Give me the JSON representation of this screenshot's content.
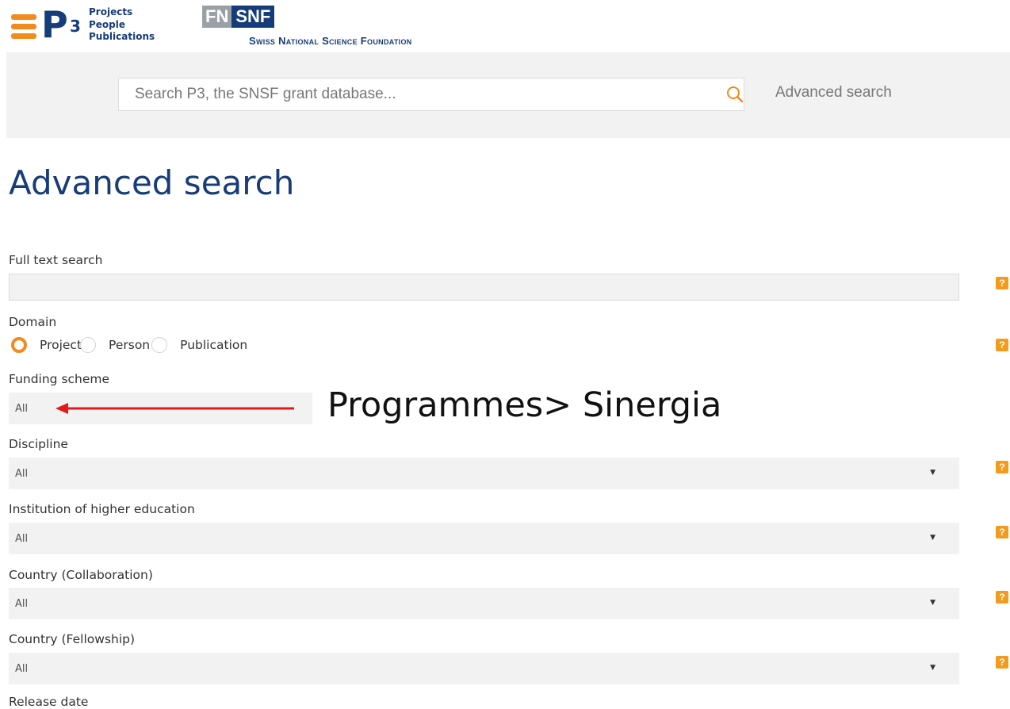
{
  "header": {
    "p3_letters": "P",
    "p3_sup": "3",
    "p3_words": [
      "Projects",
      "People",
      "Publications"
    ],
    "snf_logo_left": "FN",
    "snf_logo_right": "SNF",
    "snf_tagline": "Swiss National Science Foundation"
  },
  "search": {
    "placeholder": "Search P3, the SNSF grant database...",
    "value": "",
    "advanced_link": "Advanced search"
  },
  "page": {
    "title": "Advanced search"
  },
  "form": {
    "full_text_label": "Full text search",
    "full_text_value": "",
    "help_glyph": "?",
    "domain_label": "Domain",
    "domain_options": [
      "Project",
      "Person",
      "Publication"
    ],
    "domain_selected": "Project",
    "funding_label": "Funding scheme",
    "funding_value": "All",
    "discipline_label": "Discipline",
    "discipline_value": "All",
    "institution_label": "Institution of higher education",
    "institution_value": "All",
    "country_collab_label": "Country (Collaboration)",
    "country_collab_value": "All",
    "country_fellow_label": "Country (Fellowship)",
    "country_fellow_value": "All",
    "next_label_partial": "Release date"
  },
  "annotation": {
    "text": "Programmes> Sinergia",
    "arrow_color": "#e3191c"
  },
  "colors": {
    "brand_blue": "#173c7a",
    "accent_orange": "#f28a1e",
    "help_orange": "#f29c1f",
    "field_bg": "#f2f2f2"
  }
}
